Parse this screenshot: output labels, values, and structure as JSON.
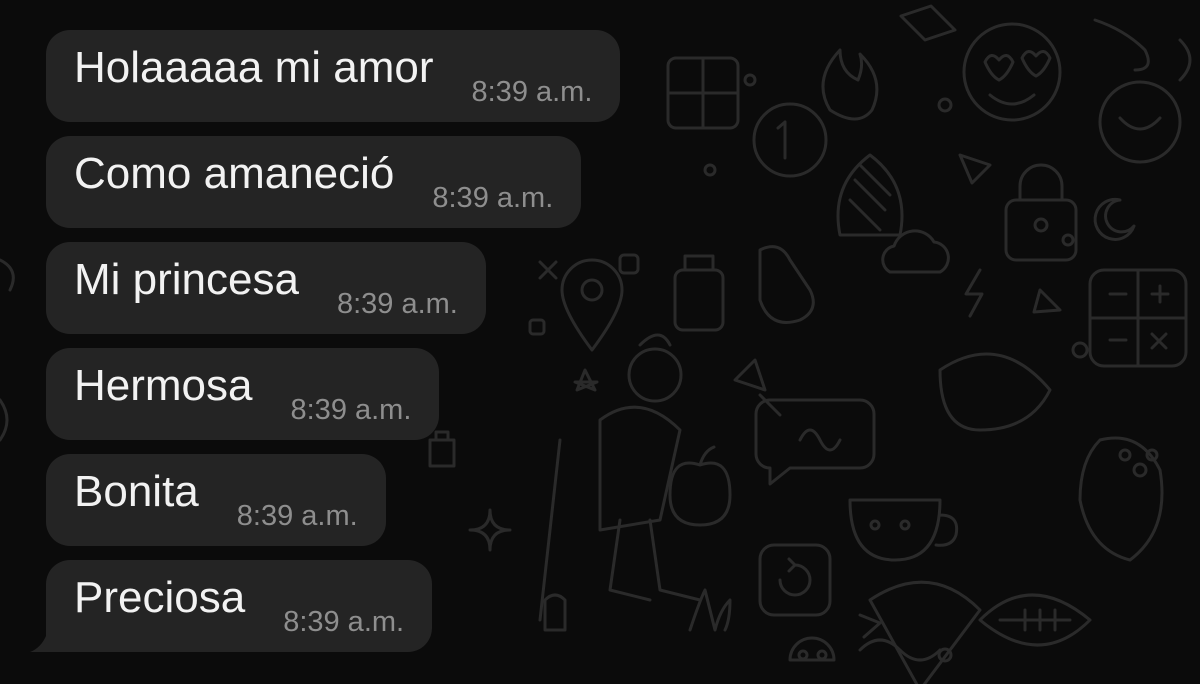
{
  "chat": {
    "messages": [
      {
        "text": "Holaaaaa mi amor",
        "time": "8:39 a.m."
      },
      {
        "text": "Como amaneció",
        "time": "8:39 a.m."
      },
      {
        "text": "Mi princesa",
        "time": "8:39 a.m."
      },
      {
        "text": "Hermosa",
        "time": "8:39 a.m."
      },
      {
        "text": "Bonita",
        "time": "8:39 a.m."
      },
      {
        "text": "Preciosa",
        "time": "8:39 a.m."
      }
    ]
  },
  "theme": {
    "background": "#0b0b0b",
    "bubble": "#242424",
    "text": "#f2f2f2",
    "time": "#8e8e8e",
    "doodle": "#2a2a2a"
  }
}
